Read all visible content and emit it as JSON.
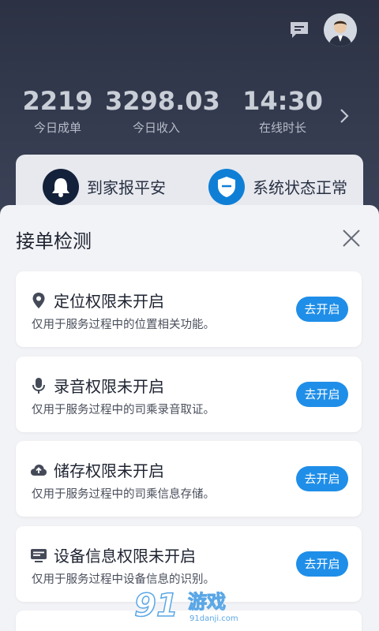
{
  "header": {
    "stats": [
      {
        "value": "2219",
        "label": "今日成单"
      },
      {
        "value": "3298.03",
        "label": "今日收入"
      },
      {
        "value": "14:30",
        "label": "在线时长"
      }
    ]
  },
  "info_bar": {
    "items": [
      {
        "label": "到家报平安",
        "icon": "bell-icon"
      },
      {
        "label": "系统状态正常",
        "icon": "shield-icon"
      }
    ]
  },
  "sheet": {
    "title": "接单检测",
    "cards": [
      {
        "title": "定位权限未开启",
        "desc": "仅用于服务过程中的位置相关功能。",
        "button": "去开启",
        "icon": "location-pin-icon"
      },
      {
        "title": "录音权限未开启",
        "desc": "仅用于服务过程中的司乘录音取证。",
        "button": "去开启",
        "icon": "microphone-icon"
      },
      {
        "title": "储存权限未开启",
        "desc": "仅用于服务过程中的司乘信息存储。",
        "button": "去开启",
        "icon": "cloud-upload-icon"
      },
      {
        "title": "设备信息权限未开启",
        "desc": "仅用于服务过程中设备信息的识别。",
        "button": "去开启",
        "icon": "device-info-icon"
      }
    ]
  },
  "watermark": {
    "num": "91",
    "text": "游戏",
    "url": "91danji.com"
  },
  "colors": {
    "accent": "#1f8ee8",
    "dark_header": "#2c3244",
    "sheet_bg": "#f2f3f6"
  }
}
